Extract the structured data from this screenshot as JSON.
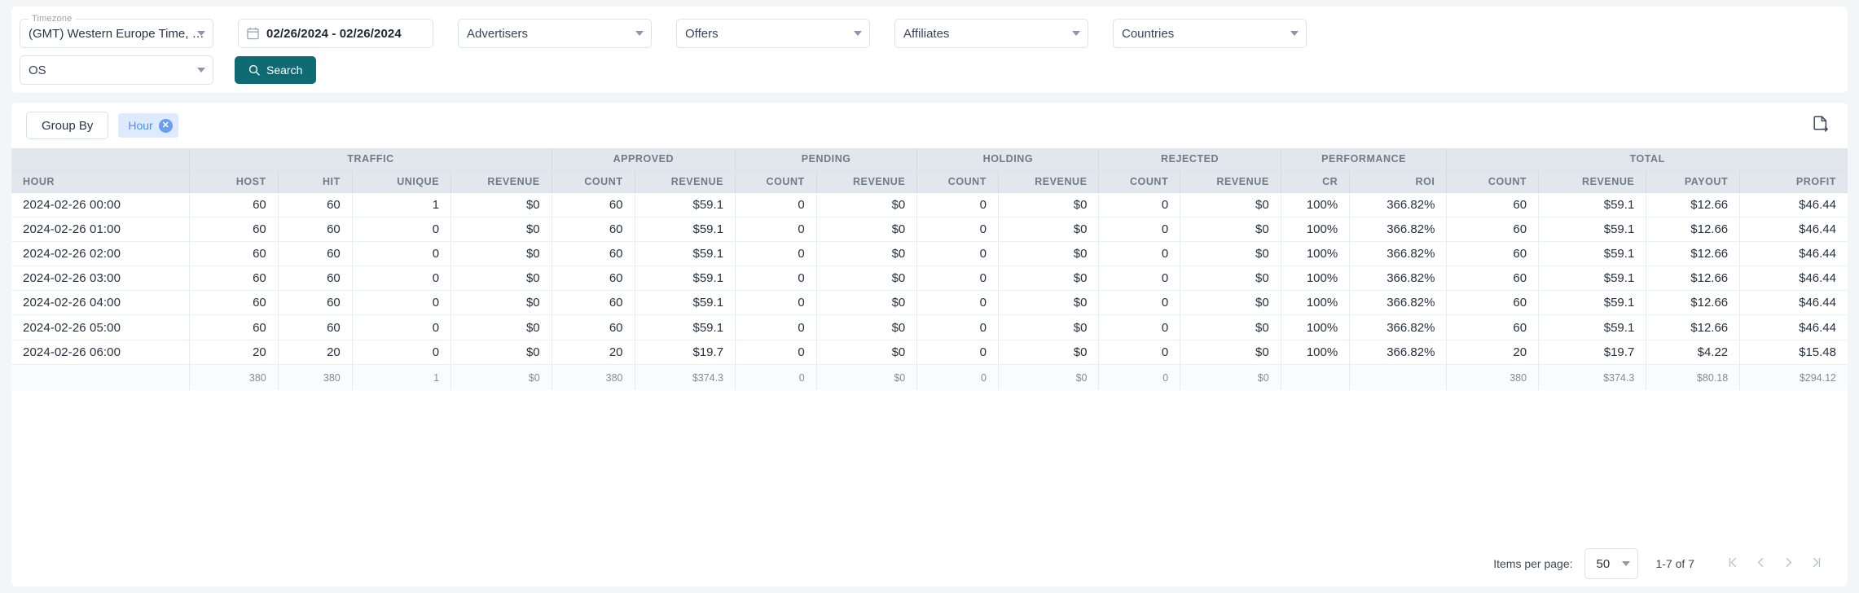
{
  "filters": {
    "timezone": {
      "label": "Timezone",
      "value": "(GMT) Western Europe Time, London, …"
    },
    "date_range": {
      "value": "02/26/2024 - 02/26/2024",
      "icon": "calendar-icon"
    },
    "advertisers": {
      "placeholder": "Advertisers"
    },
    "offers": {
      "placeholder": "Offers"
    },
    "affiliates": {
      "placeholder": "Affiliates"
    },
    "countries": {
      "placeholder": "Countries"
    },
    "os": {
      "placeholder": "OS"
    },
    "search_button": {
      "label": "Search",
      "icon": "search-icon",
      "color": "#0e6b74"
    }
  },
  "toolbar": {
    "group_by_label": "Group By",
    "chips": [
      {
        "label": "Hour",
        "remove_icon": "close-icon"
      }
    ],
    "export_icon": "export-file-icon"
  },
  "table": {
    "group_headers": [
      {
        "label": "",
        "span": 1
      },
      {
        "label": "TRAFFIC",
        "span": 4
      },
      {
        "label": "APPROVED",
        "span": 2
      },
      {
        "label": "PENDING",
        "span": 2
      },
      {
        "label": "HOLDING",
        "span": 2
      },
      {
        "label": "REJECTED",
        "span": 2
      },
      {
        "label": "PERFORMANCE",
        "span": 2
      },
      {
        "label": "TOTAL",
        "span": 4
      }
    ],
    "columns": [
      "HOUR",
      "HOST",
      "HIT",
      "UNIQUE",
      "REVENUE",
      "COUNT",
      "REVENUE",
      "COUNT",
      "REVENUE",
      "COUNT",
      "REVENUE",
      "COUNT",
      "REVENUE",
      "CR",
      "ROI",
      "COUNT",
      "REVENUE",
      "PAYOUT",
      "PROFIT"
    ],
    "rows": [
      [
        "2024-02-26 00:00",
        "60",
        "60",
        "1",
        "$0",
        "60",
        "$59.1",
        "0",
        "$0",
        "0",
        "$0",
        "0",
        "$0",
        "100%",
        "366.82%",
        "60",
        "$59.1",
        "$12.66",
        "$46.44"
      ],
      [
        "2024-02-26 01:00",
        "60",
        "60",
        "0",
        "$0",
        "60",
        "$59.1",
        "0",
        "$0",
        "0",
        "$0",
        "0",
        "$0",
        "100%",
        "366.82%",
        "60",
        "$59.1",
        "$12.66",
        "$46.44"
      ],
      [
        "2024-02-26 02:00",
        "60",
        "60",
        "0",
        "$0",
        "60",
        "$59.1",
        "0",
        "$0",
        "0",
        "$0",
        "0",
        "$0",
        "100%",
        "366.82%",
        "60",
        "$59.1",
        "$12.66",
        "$46.44"
      ],
      [
        "2024-02-26 03:00",
        "60",
        "60",
        "0",
        "$0",
        "60",
        "$59.1",
        "0",
        "$0",
        "0",
        "$0",
        "0",
        "$0",
        "100%",
        "366.82%",
        "60",
        "$59.1",
        "$12.66",
        "$46.44"
      ],
      [
        "2024-02-26 04:00",
        "60",
        "60",
        "0",
        "$0",
        "60",
        "$59.1",
        "0",
        "$0",
        "0",
        "$0",
        "0",
        "$0",
        "100%",
        "366.82%",
        "60",
        "$59.1",
        "$12.66",
        "$46.44"
      ],
      [
        "2024-02-26 05:00",
        "60",
        "60",
        "0",
        "$0",
        "60",
        "$59.1",
        "0",
        "$0",
        "0",
        "$0",
        "0",
        "$0",
        "100%",
        "366.82%",
        "60",
        "$59.1",
        "$12.66",
        "$46.44"
      ],
      [
        "2024-02-26 06:00",
        "20",
        "20",
        "0",
        "$0",
        "20",
        "$19.7",
        "0",
        "$0",
        "0",
        "$0",
        "0",
        "$0",
        "100%",
        "366.82%",
        "20",
        "$19.7",
        "$4.22",
        "$15.48"
      ]
    ],
    "totals": [
      "",
      "380",
      "380",
      "1",
      "$0",
      "380",
      "$374.3",
      "0",
      "$0",
      "0",
      "$0",
      "0",
      "$0",
      "",
      "",
      "380",
      "$374.3",
      "$80.18",
      "$294.12"
    ]
  },
  "paginator": {
    "items_per_page_label": "Items per page:",
    "items_per_page_value": "50",
    "range_label": "1-7 of 7",
    "first_icon": "first-page-icon",
    "prev_icon": "previous-page-icon",
    "next_icon": "next-page-icon",
    "last_icon": "last-page-icon"
  }
}
